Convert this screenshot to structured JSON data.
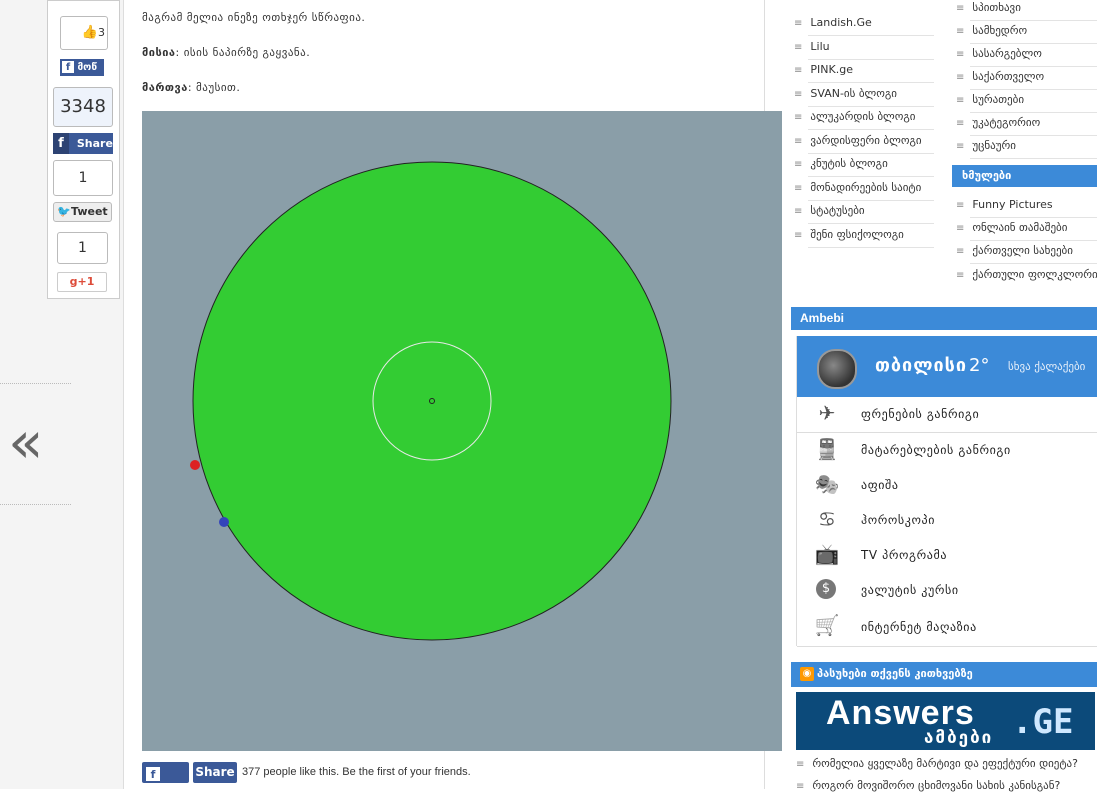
{
  "left": {
    "like_count_top": "3",
    "fb_like_short": "მოწ",
    "share_count": "3348",
    "share_label": "Share",
    "tweet_count": "1",
    "tweet_label": "Tweet",
    "gplus_count": "1",
    "gplus_label": "+1",
    "prev_arrow": "«"
  },
  "main": {
    "line1": "მაგრამ მელია ინეზე ოთხჯერ სწრაფია.",
    "q_label": "მისია",
    "q_text": ": ისის ნაპირზე გაყვანა.",
    "a_label": "მართვა",
    "a_text": ": მაუსით.",
    "footer_like": "Like",
    "footer_share": "Share",
    "footer_text": "377 people like this. Be the first of your friends."
  },
  "sidebar_links": [
    "Landish.Ge",
    "Lilu",
    "PINK.ge",
    "SVAN-ის ბლოგი",
    "ალუკარდის ბლოგი",
    "ვარდისფერი ბლოგი",
    "კნუტის ბლოგი",
    "მონადირეების საიტი",
    "სტატუსები",
    "შენი ფსიქოლოგი"
  ],
  "sidebar_categories": [
    "სპითხავი",
    "სამხედრო",
    "სასარგებლო",
    "საქართველო",
    "სურათები",
    "უკატეგორიო",
    "უცნაური"
  ],
  "funny_header": "ხმულები",
  "funny_items": [
    "Funny Pictures",
    "ონლაინ თამაშები",
    "ქართველი სახეები",
    "ქართული ფოლკლორი"
  ],
  "ambebi": {
    "header": "Ambebi",
    "city": "თბილისი",
    "temp": "2°",
    "other_cities": "სხვა ქალაქები",
    "rows": [
      {
        "icon": "airplane-icon",
        "label": "ფრენების განრიგი"
      },
      {
        "icon": "train-icon",
        "label": "მატარებლების განრიგი"
      },
      {
        "icon": "theater-masks-icon",
        "label": "აფიშა"
      },
      {
        "icon": "horoscope-icon",
        "label": "ჰოროსკოპი"
      },
      {
        "icon": "tv-icon",
        "label": "TV პროგრამა"
      },
      {
        "icon": "dollar-coin-icon",
        "label": "ვალუტის კურსი"
      },
      {
        "icon": "shopping-cart-icon",
        "label": "ინტერნეტ მაღაზია"
      }
    ]
  },
  "answers": {
    "header": "პასუხები თქვენს კითხვებზე",
    "logo_main": "Answers",
    "logo_ge": ".GE",
    "logo_sub": "ამბები",
    "q1": "რომელია ყველაზე მარტივი და ეფექტური დიეტა?",
    "q2": "როგორ მოვიშორო ცხიმოვანი სახის კანისგან?"
  },
  "colors": {
    "game_bg": "#8a9ea8",
    "lake_green": "#33cc33",
    "fox_red": "#dd2222",
    "player_blue": "#3344bb",
    "accent_blue": "#3c8ad8"
  }
}
